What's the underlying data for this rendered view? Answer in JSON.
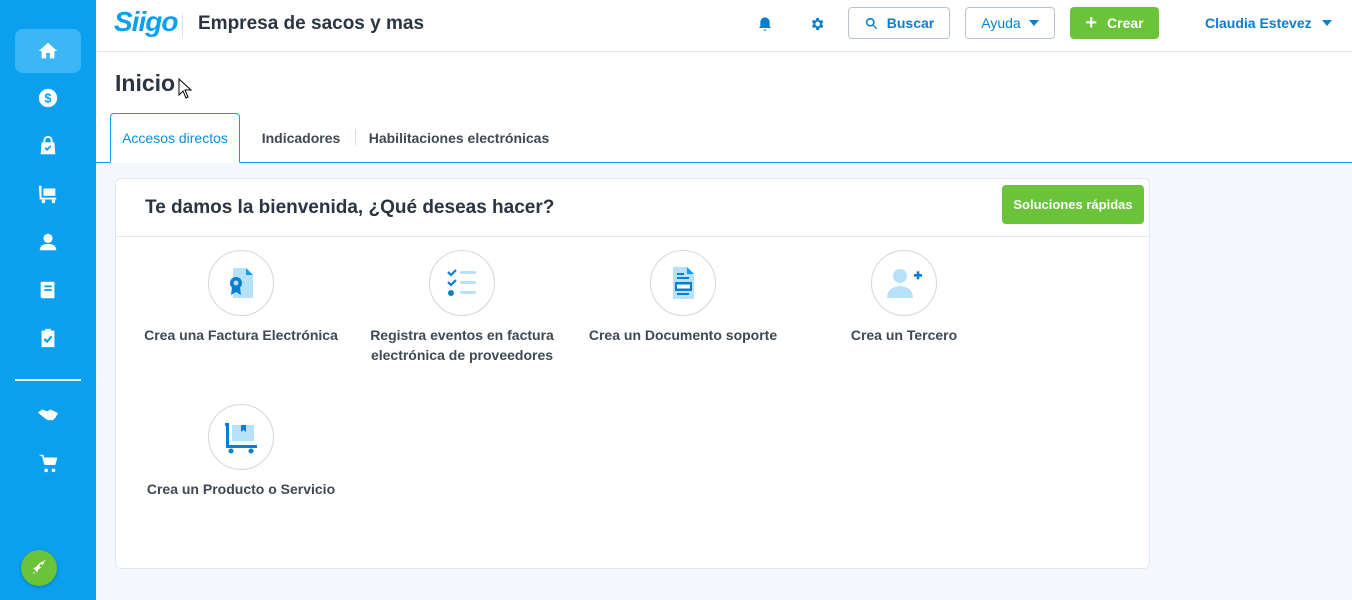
{
  "app": {
    "logo": "Siigo",
    "company": "Empresa de sacos y mas"
  },
  "topbar": {
    "search_label": "Buscar",
    "help_label": "Ayuda",
    "create_label": "Crear",
    "user_name": "Claudia Estevez"
  },
  "page": {
    "title": "Inicio"
  },
  "tabs": [
    {
      "label": "Accesos directos",
      "active": true
    },
    {
      "label": "Indicadores",
      "active": false
    },
    {
      "label": "Habilitaciones electrónicas",
      "active": false
    }
  ],
  "card": {
    "title": "Te damos la bienvenida, ¿Qué deseas hacer?",
    "quick_button": "Soluciones rápidas",
    "actions": [
      {
        "label": "Crea una Factura Electrónica",
        "icon": "invoice-icon"
      },
      {
        "label": "Registra eventos en factura electrónica de proveedores",
        "icon": "checklist-icon"
      },
      {
        "label": "Crea un Documento soporte",
        "icon": "document-icon"
      },
      {
        "label": "Crea un Tercero",
        "icon": "add-person-icon"
      },
      {
        "label": "Crea un Producto o Servicio",
        "icon": "cart-box-icon"
      }
    ]
  },
  "sidebar": {
    "items": [
      {
        "icon": "home-icon",
        "active": true
      },
      {
        "icon": "money-icon"
      },
      {
        "icon": "shopping-bag-icon"
      },
      {
        "icon": "inventory-cart-icon"
      },
      {
        "icon": "person-icon"
      },
      {
        "icon": "book-icon"
      },
      {
        "icon": "clipboard-check-icon"
      },
      {
        "icon": "handshake-icon"
      },
      {
        "icon": "cart-icon"
      }
    ],
    "bottom_icon": "rocket-icon"
  },
  "colors": {
    "brand_blue": "#0aa0ee",
    "accent_green": "#6bc33a",
    "link_blue": "#0a7fd1"
  }
}
